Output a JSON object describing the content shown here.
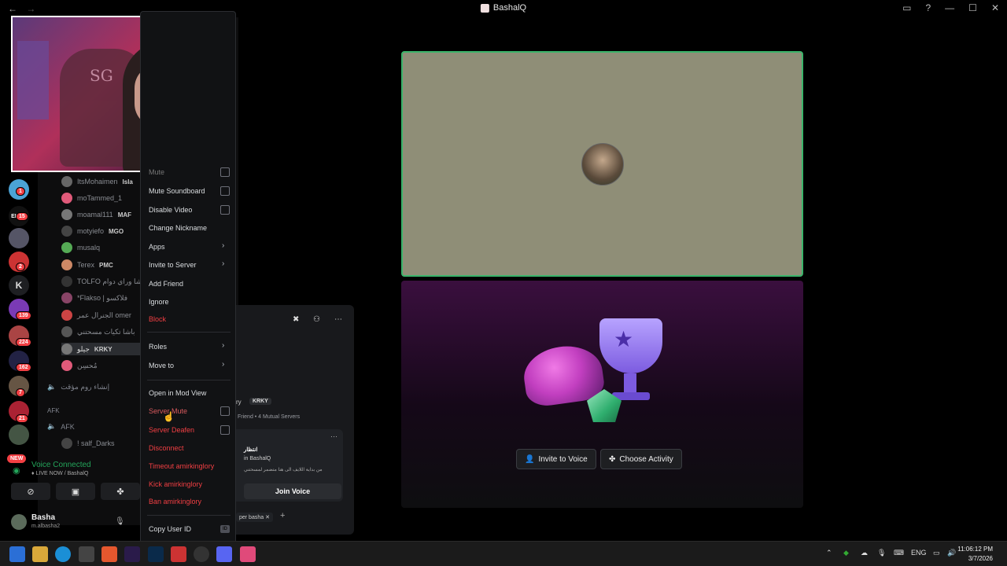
{
  "window": {
    "title": "BashalQ",
    "nav_back": "←",
    "nav_forward": "→"
  },
  "servers": {
    "badges": [
      "1",
      "15",
      "2",
      "139",
      "224",
      "162",
      "7",
      "21"
    ],
    "letter_server": "K",
    "new_label": "NEW",
    "label_fragment": "ELMA"
  },
  "members": [
    {
      "name": "ItsMohaimen",
      "tag": "Isla"
    },
    {
      "name": "moTammed_1",
      "tag": ""
    },
    {
      "name": "moamal111",
      "tag": "MAF"
    },
    {
      "name": "motyiefo",
      "tag": "MGO"
    },
    {
      "name": "musalq",
      "tag": ""
    },
    {
      "name": "Terex",
      "tag": "PMC"
    },
    {
      "name": "TOLFO باشا وراي دوام",
      "tag": ""
    },
    {
      "name": "*Flakso | فلاكسو",
      "tag": ""
    },
    {
      "name": "الجنرال عمر omer",
      "tag": ""
    },
    {
      "name": "باشا تكيات مسحتني",
      "tag": ""
    },
    {
      "name": "جيلو",
      "tag": "KRKY"
    },
    {
      "name": "مُحسِن",
      "tag": ""
    }
  ],
  "channels": {
    "create_room": "إنشاء روم مؤقت",
    "afk_category": "AFK",
    "afk_channel": "AFK",
    "afk_member": "! salf_Darks"
  },
  "voice": {
    "status": "Voice Connected",
    "sub": "♦ LIVE NOW / BashalQ"
  },
  "user": {
    "name": "Basha",
    "handle": "m.albasha2"
  },
  "context_menu": {
    "mute": "Mute",
    "mute_soundboard": "Mute Soundboard",
    "disable_video": "Disable Video",
    "change_nickname": "Change Nickname",
    "apps": "Apps",
    "invite_to_server": "Invite to Server",
    "add_friend": "Add Friend",
    "ignore": "Ignore",
    "block": "Block",
    "roles": "Roles",
    "move_to": "Move to",
    "open_mod_view": "Open in Mod View",
    "server_mute": "Server Mute",
    "server_deafen": "Server Deafen",
    "disconnect": "Disconnect",
    "timeout": "Timeout amirkinglory",
    "kick": "Kick amirkinglory",
    "ban": "Ban amirkinglory",
    "copy_user_id": "Copy User ID",
    "id_badge": "ID"
  },
  "profile": {
    "name_fragment": "ry",
    "tag": "KRKY",
    "mutual": "Friend • 4 Mutual Servers",
    "activity_title": "انتظار",
    "activity_in": "in BashalQ",
    "activity_desc": "من بداية اللايف الى هنا متضمر لمسحتني",
    "join_voice": "Join Voice",
    "chip": "per basha"
  },
  "stage": {
    "invite_voice": "Invite to Voice",
    "choose_activity": "Choose Activity"
  },
  "taskbar": {
    "lang": "ENG",
    "time": "11:06:12 PM",
    "date": "3/7/2026"
  },
  "colors": {
    "accent_green": "#23a55a",
    "danger_red": "#f23f43",
    "tile_bg": "#8f8e77"
  }
}
